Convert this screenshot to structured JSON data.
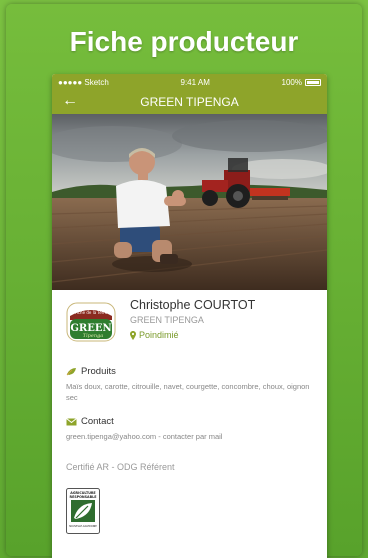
{
  "page": {
    "title": "Fiche producteur"
  },
  "statusbar": {
    "carrier": "●●●●● Sketch",
    "time": "9:41 AM",
    "battery": "100%"
  },
  "navbar": {
    "back_icon": "arrow-left-icon",
    "title": "GREEN TIPENGA"
  },
  "producer": {
    "name": "Christophe COURTOT",
    "company": "GREEN TIPENGA",
    "location": "Poindimié",
    "logo_text_top": "Fiche de la Terre",
    "logo_text_main": "GREEN",
    "logo_text_sub": "Tipenga"
  },
  "products": {
    "title": "Produits",
    "text": "Maïs doux, carotte, citrouille, navet, courgette, concombre, choux, oignon sec"
  },
  "contact": {
    "title": "Contact",
    "text": "green.tipenga@yahoo.com - contacter par mail"
  },
  "certification": {
    "text": "Certifié AR - ODG Référent",
    "badge_line1": "AGRICULTURE",
    "badge_line2": "RESPONSABLE",
    "badge_line3": "NOUVELLE-CALEDONIE"
  },
  "colors": {
    "brand": "#8ea42a",
    "background": "#6db53a",
    "location": "#7a9a2a"
  }
}
